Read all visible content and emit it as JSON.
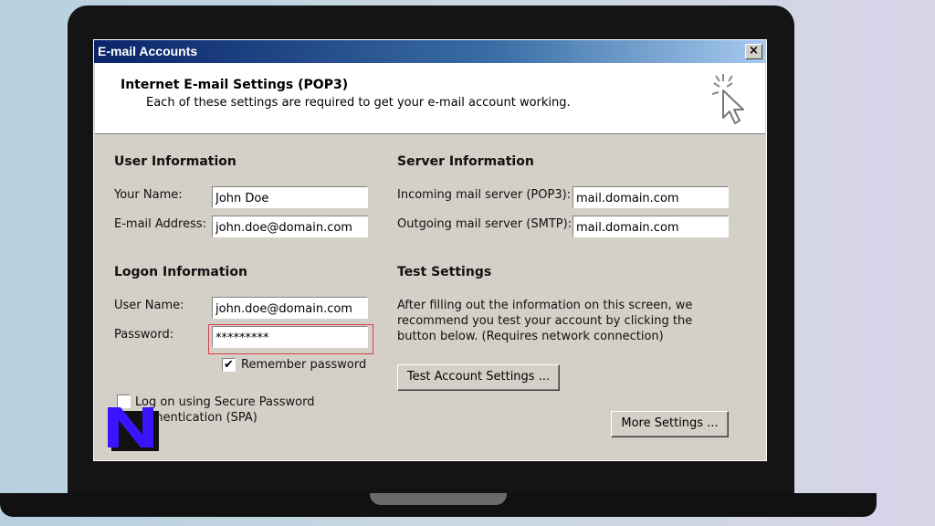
{
  "window": {
    "title": "E-mail Accounts",
    "close_glyph": "×"
  },
  "header": {
    "title": "Internet E-mail Settings (POP3)",
    "subtitle": "Each of these settings are required to get your e-mail account working."
  },
  "user_info": {
    "heading": "User Information",
    "name_label": "Your Name:",
    "name_value": "John Doe",
    "email_label": "E-mail Address:",
    "email_value": "john.doe@domain.com"
  },
  "server_info": {
    "heading": "Server Information",
    "incoming_label": "Incoming mail server (POP3):",
    "incoming_value": "mail.domain.com",
    "outgoing_label": "Outgoing mail server (SMTP):",
    "outgoing_value": "mail.domain.com"
  },
  "logon_info": {
    "heading": "Logon Information",
    "username_label": "User Name:",
    "username_value": "john.doe@domain.com",
    "password_label": "Password:",
    "password_value": "*********",
    "remember_label": "Remember password",
    "remember_checked": "✔",
    "spa_label_line1": "Log on using Secure Password",
    "spa_label_line2": "Authentication (SPA)"
  },
  "test_settings": {
    "heading": "Test Settings",
    "description": "After filling out the information on this screen, we recommend you test your account by clicking the button below. (Requires network connection)",
    "test_button": "Test Account Settings ...",
    "more_button": "More Settings ..."
  },
  "colors": {
    "titlebar_start": "#0a246a",
    "dialog_bg": "#d4d0c8",
    "highlight": "#d8404a",
    "logo_blue": "#3a14ff"
  },
  "icons": {
    "wizard": "wizard-cursor-icon",
    "logo": "n-logo-icon"
  }
}
